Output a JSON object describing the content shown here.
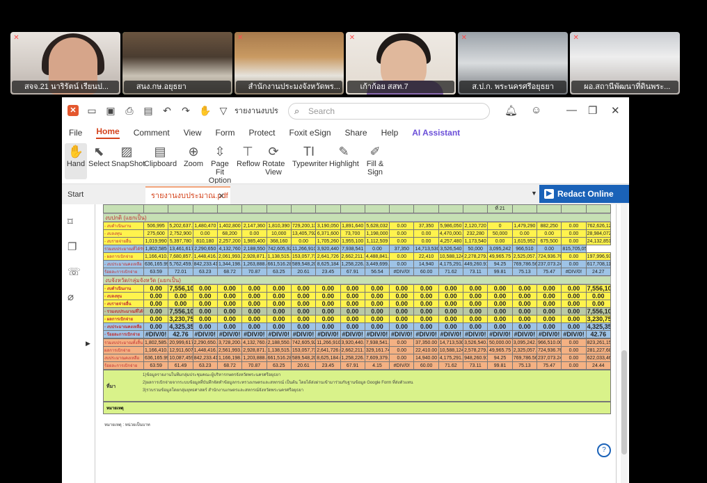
{
  "meeting": {
    "participants": [
      {
        "name": "สจจ.21 นาริรัตน์ เรียนป...",
        "active": false
      },
      {
        "name": "สนง.กษ.อยุธยา",
        "active": true
      },
      {
        "name": "สำนักงานประมงจังหวัดพร...",
        "active": false
      },
      {
        "name": "เก้าก้อย สสท.7",
        "active": false
      },
      {
        "name": "ส.ป.ก. พระนครศรีอยุธยา",
        "active": false
      },
      {
        "name": "ผอ.สถานีพัฒนาที่ดินพระ...",
        "active": false
      }
    ]
  },
  "app": {
    "title_doc": "รายงานงบประม...",
    "search_placeholder": "Search",
    "menu": [
      "File",
      "Home",
      "Comment",
      "View",
      "Form",
      "Protect",
      "Foxit eSign",
      "Share",
      "Help",
      "AI Assistant"
    ],
    "ribbon": {
      "hand": "Hand",
      "select": "Select",
      "snapshot": "SnapShot",
      "clipboard": "Clipboard",
      "zoom": "Zoom",
      "pagefit": "Page Fit Option",
      "reflow": "Reflow",
      "rotate": "Rotate View",
      "typewriter": "Typewriter",
      "highlight": "Highlight",
      "fillsign": "Fill & Sign"
    },
    "tabs": {
      "start": "Start",
      "doc": "รายงานงบประมาณ.pdf",
      "redact": "Redact Online"
    },
    "colors": {
      "accent": "#d4431c",
      "redact": "#1a62b8"
    }
  },
  "sheet": {
    "top_marker": "ที่ 21",
    "sec1_title": "งบปกติ (แยกเป็น)",
    "sec1_rows": [
      {
        "label": "- งบดำเนินงาน",
        "color": "y",
        "cells": [
          "506,995",
          "5,202,637.22",
          "1,480,470",
          "1,402,800",
          "2,147,360",
          "1,810,390",
          "729,200,134",
          "3,190,050",
          "1,891,640",
          "5,628,032",
          "0.00",
          "37,350",
          "5,986,050",
          "2,120,720",
          "0",
          "1,479,290",
          "882,250",
          "0.00",
          "762,626,128.32"
        ]
      },
      {
        "label": "- งบลงทุน",
        "color": "y",
        "cells": [
          "275,600",
          "2,752,900",
          "0.00",
          "68,200",
          "0.00",
          "10,000",
          "13,405,792.18",
          "6,371,600",
          "73,700",
          "1,198,000",
          "0.00",
          "0.00",
          "4,470,000.00",
          "232,280",
          "50,000",
          "0.00",
          "0.00",
          "0.00",
          "28,984,072.18"
        ]
      },
      {
        "label": "- งบรายจ่ายอื่น",
        "color": "y",
        "cells": [
          "1,019,990",
          "5,397,780",
          "810,180",
          "2,257,200",
          "1,985,400",
          "368,160",
          "0.00",
          "1,705,260",
          "1,955,100",
          "1,112,509",
          "0.00",
          "0.00",
          "4,257,480",
          "1,173,540",
          "0.00",
          "1,615,952",
          "675,500",
          "0.00",
          "24,132,851"
        ]
      },
      {
        "label": "รวมงบประมาณที่ได้รับ",
        "color": "b",
        "cells": [
          "1,802,585",
          "13,461,617.22",
          "2,290,650",
          "4,132,760",
          "2,188,550",
          "742,605,926.28",
          "11,266,910",
          "3,920,440",
          "7,938,541",
          "0.00",
          "37,350",
          "14,713,530",
          "3,526,540",
          "50,000",
          "3,095,242",
          "966,510",
          "0.00",
          "815,705,051.50"
        ]
      },
      {
        "label": "- ผลการเบิกจ่าย",
        "color": "y",
        "cells": [
          "1,166,410.00",
          "7,680,857.30",
          "1,448,416.59",
          "2,061,993.00",
          "2,928,871.58",
          "1,138,515.79",
          "153,057,719.79",
          "2,641,726",
          "2,662,211.78",
          "4,488,841.82",
          "0.00",
          "22,410",
          "10,588,124.39",
          "2,278,279.09",
          "49,965.75",
          "2,525,057.40",
          "724,936.76",
          "0.00",
          "197,996,932.21"
        ]
      },
      {
        "label": "- งบประมาณคงเหลือ",
        "color": "b",
        "cells": [
          "636,165.99",
          "5,762,459.92",
          "842,233.41",
          "1,344,198.67",
          "1,263,888.45",
          "661,516.28",
          "589,548,206.49",
          "8,625,184",
          "1,258,226.30",
          "3,449,699.18",
          "0.00",
          "14,940",
          "4,175,291.61",
          "449,260.91",
          "94.25",
          "769,786.56",
          "237,073.24",
          "0.00",
          "617,708,119.29"
        ]
      },
      {
        "label": "ร้อยละการเบิกจ่าย",
        "color": "b",
        "cells": [
          "63.59",
          "72.01",
          "63.23",
          "68.72",
          "70.87",
          "63.25",
          "20.61",
          "23.45",
          "67.91",
          "56.54",
          "#DIV/0!",
          "60.00",
          "71.62",
          "73.11",
          "99.81",
          "75.13",
          "75.47",
          "#DIV/0!",
          "24.27"
        ]
      }
    ],
    "sec2_title": "งบจังหวัด/กลุ่มจังหวัด (แยกเป็น)",
    "sec2_rows": [
      {
        "label": "- งบดำเนินงาน",
        "color": "y",
        "cells": [
          "0.00",
          "7,556,100",
          "0.00",
          "0.00",
          "0.00",
          "0.00",
          "0.00",
          "0.00",
          "0.00",
          "0.00",
          "0.00",
          "0.00",
          "0.00",
          "0.00",
          "0.00",
          "0.00",
          "0.00",
          "0.00",
          "7,556,100"
        ]
      },
      {
        "label": "- งบลงทุน",
        "color": "y",
        "cells": [
          "0.00",
          "0.00",
          "0.00",
          "0.00",
          "0.00",
          "0.00",
          "0.00",
          "0.00",
          "0.00",
          "0.00",
          "0.00",
          "0.00",
          "0.00",
          "0.00",
          "0.00",
          "0.00",
          "0.00",
          "0.00",
          "0.00"
        ]
      },
      {
        "label": "- งบรายจ่ายอื่น",
        "color": "y",
        "cells": [
          "0.00",
          "0.00",
          "0.00",
          "0.00",
          "0.00",
          "0.00",
          "0.00",
          "0.00",
          "0.00",
          "0.00",
          "0.00",
          "0.00",
          "0.00",
          "0.00",
          "0.00",
          "0.00",
          "0.00",
          "0.00",
          "0.00"
        ]
      },
      {
        "label": "- รวมงบประมาณที่ได้รับ",
        "color": "g",
        "cells": [
          "0.00",
          "7,556,100",
          "0.00",
          "0.00",
          "0.00",
          "0.00",
          "0.00",
          "0.00",
          "0.00",
          "0.00",
          "0.00",
          "0.00",
          "0.00",
          "0.00",
          "0.00",
          "0.00",
          "0.00",
          "0.00",
          "7,556,100"
        ]
      },
      {
        "label": "- ผลการเบิกจ่าย",
        "color": "y",
        "cells": [
          "0.00",
          "3,230,750.00",
          "0.00",
          "0.00",
          "0.00",
          "0.00",
          "0.00",
          "0.00",
          "0.00",
          "0.00",
          "0.00",
          "0.00",
          "0.00",
          "0.00",
          "0.00",
          "0.00",
          "0.00",
          "0.00",
          "3,230,750"
        ]
      },
      {
        "label": "- งบประมาณคงเหลือ",
        "color": "b",
        "cells": [
          "0.00",
          "4,325,350",
          "0.00",
          "0.00",
          "0.00",
          "0.00",
          "0.00",
          "0.00",
          "0.00",
          "0.00",
          "0.00",
          "0.00",
          "0.00",
          "0.00",
          "0.00",
          "0.00",
          "0.00",
          "0.00",
          "4,325,350"
        ]
      },
      {
        "label": "- ร้อยละการเบิกจ่าย",
        "color": "b",
        "cells": [
          "#DIV/0!",
          "42.76",
          "#DIV/0!",
          "#DIV/0!",
          "#DIV/0!",
          "#DIV/0!",
          "#DIV/0!",
          "#DIV/0!",
          "#DIV/0!",
          "#DIV/0!",
          "#DIV/0!",
          "#DIV/0!",
          "#DIV/0!",
          "#DIV/0!",
          "#DIV/0!",
          "#DIV/0!",
          "#DIV/0!",
          "#DIV/0!",
          "42.76"
        ]
      }
    ],
    "sec3_rows": [
      {
        "label": "รวมงบประมาณทั้งสิ้น",
        "color": "o",
        "cells": [
          "1,802,585.00",
          "20,999,617.22",
          "2,290,650.00",
          "3,728,200.00",
          "4,132,760.00",
          "2,188,550.00",
          "742,605,926.28",
          "11,266,910.00",
          "3,920,440.00",
          "7,938,541.00",
          "0.00",
          "37,350.00",
          "14,713,530.00",
          "3,526,540.00",
          "50,000.00",
          "3,095,242.00",
          "966,510.00",
          "0.00",
          "823,261,151.50"
        ]
      },
      {
        "label": "ผลการเบิกจ่าย",
        "color": "o",
        "cells": [
          "1,166,410.00",
          "12,911,607.30",
          "1,448,416.59",
          "2,561,993.00",
          "2,928,871.58",
          "1,138,515.79",
          "153,057,719.79",
          "2,641,726.00",
          "2,662,211.78",
          "329,161.74",
          "0.00",
          "22,410.00",
          "10,588,124.39",
          "2,578,279.09",
          "49,965.75",
          "2,325,057.40",
          "724,936.76",
          "0.00",
          "281,227,682.21"
        ]
      },
      {
        "label": "งบประมาณคงเหลือ",
        "color": "o",
        "cells": [
          "636,165.99",
          "10,087,459.92",
          "842,233.41",
          "1,166,198.67",
          "1,203,888.45",
          "661,516.28",
          "589,548,206.49",
          "8,625,184.00",
          "1,258,226.30",
          "7,609,379.26",
          "0.00",
          "14,940.00",
          "4,175,291.61",
          "948,260.91",
          "94.25",
          "769,786.56",
          "237,073.24",
          "0.00",
          "622,033,469.29"
        ]
      },
      {
        "label": "ร้อยละการเบิกจ่าย",
        "color": "o",
        "cells": [
          "63.59",
          "61.49",
          "63.23",
          "68.72",
          "70.87",
          "63.25",
          "20.61",
          "23.45",
          "67.91",
          "4.15",
          "#DIV/0!",
          "60.00",
          "71.62",
          "73.11",
          "99.81",
          "75.13",
          "75.47",
          "0.00",
          "24.44"
        ]
      }
    ],
    "note_label": "ที่มา",
    "notes": [
      "1)ข้อมูลรายงานในทีมกลุ่มประชุมคณะผู้บริหารกษตรจังหวัดพระนครศรีอยุธยา",
      "2)ผลการเบิกจ่ายจากระบบข้อมูลที่บันทึกจัดทำข้อมูลกระทรวงเกษตรและสหกรณ์ เป็นต้น โดยได้ส่งผ่านเข้ามาร่วมกับฐานข้อมูล Google Form ที่ส่งตัวแทน",
      "3)รวบรวมข้อมูลโดยกลุ่มยุทธศาสตร์ สำนักงานเกษตรและสหกรณ์จังหวัดพระนครศรีอยุธยา"
    ],
    "remark_label": "หมายเหตุ",
    "unit_note": "หมายเหตุ : หน่วยเป็นบาท"
  }
}
